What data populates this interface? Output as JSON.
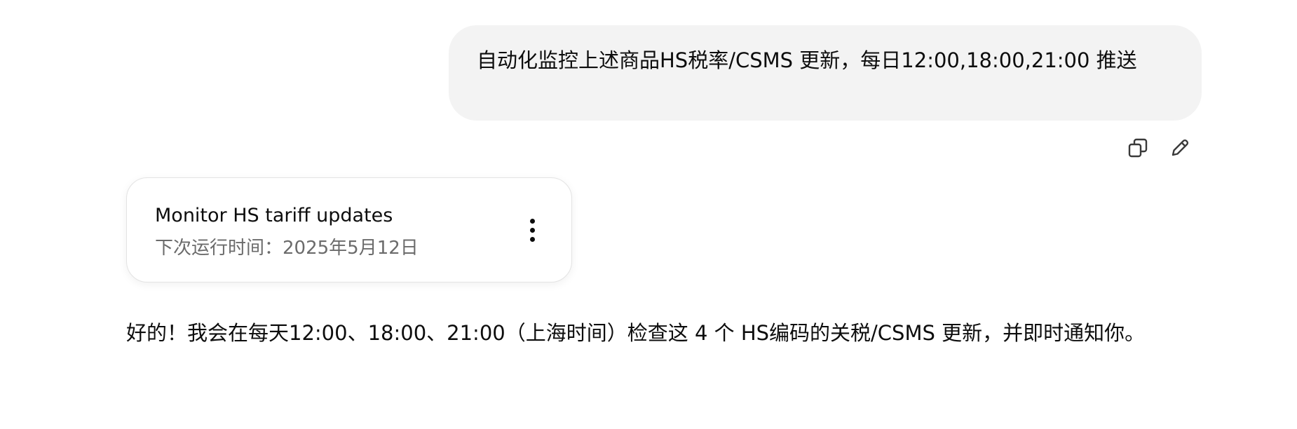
{
  "user_message": {
    "text": "自动化监控上述商品HS税率/CSMS 更新，每日12:00,18:00,21:00 推送"
  },
  "message_actions": {
    "copy_icon": "copy-icon",
    "edit_icon": "pencil-icon"
  },
  "task_card": {
    "title": "Monitor HS tariff updates",
    "subtitle": "下次运行时间：2025年5月12日",
    "menu_icon": "more-vertical-icon"
  },
  "assistant_message": {
    "text": "好的！我会在每天12:00、18:00、21:00（上海时间）检查这 4 个 HS编码的关税/CSMS 更新，并即时通知你。"
  }
}
